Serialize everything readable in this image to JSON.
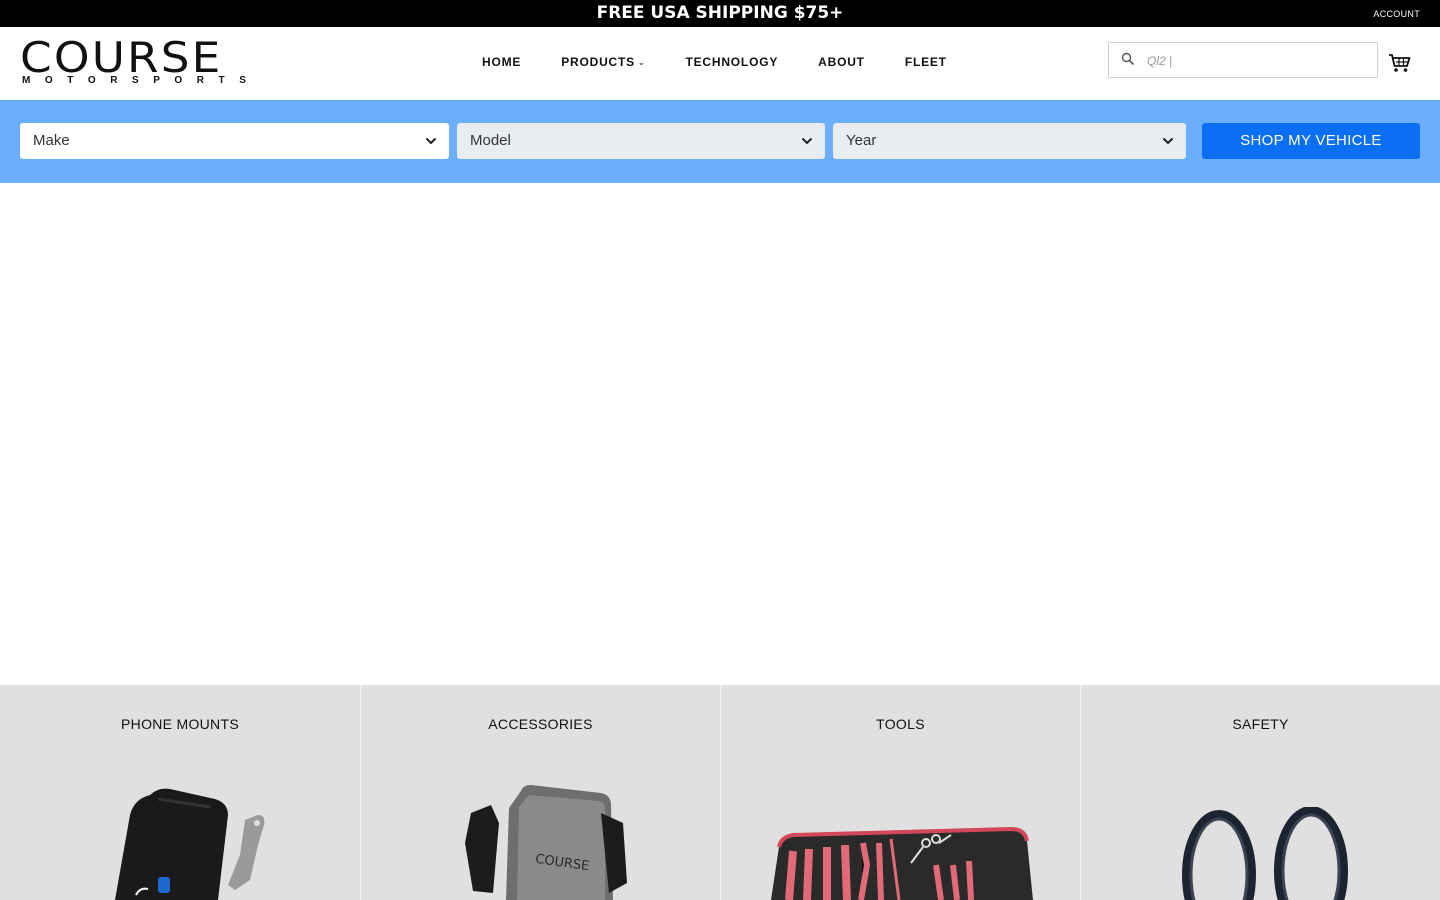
{
  "announcement": {
    "text": "FREE USA SHIPPING $75+",
    "account_label": "ACCOUNT"
  },
  "header": {
    "logo": {
      "word": "COURSE",
      "sub_letters": [
        "M",
        "O",
        "T",
        "O",
        "R",
        "S",
        "P",
        "O",
        "R",
        "T",
        "S"
      ]
    },
    "nav": [
      {
        "label": "HOME"
      },
      {
        "label": "PRODUCTS",
        "has_dropdown": true
      },
      {
        "label": "TECHNOLOGY"
      },
      {
        "label": "ABOUT"
      },
      {
        "label": "FLEET"
      }
    ],
    "search": {
      "value": "Ql2 |"
    }
  },
  "finder": {
    "make": "Make",
    "model": "Model",
    "year": "Year",
    "button": "SHOP MY VEHICLE",
    "band_color": "#6aaefc",
    "button_color": "#0a6ff2"
  },
  "categories": [
    {
      "title": "PHONE MOUNTS",
      "icon": "phone-mount-image"
    },
    {
      "title": "ACCESSORIES",
      "icon": "phone-holder-image"
    },
    {
      "title": "TOOLS",
      "icon": "tool-kit-image"
    },
    {
      "title": "SAFETY",
      "icon": "rings-image"
    }
  ]
}
